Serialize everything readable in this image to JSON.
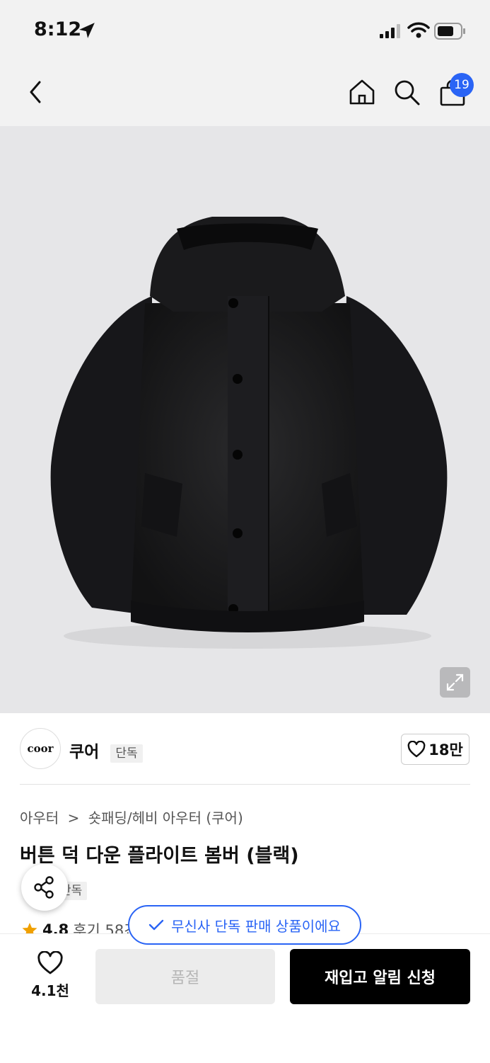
{
  "status_bar": {
    "time": "8:12"
  },
  "nav": {
    "cart_count": "19"
  },
  "brand": {
    "logo_text": "coor",
    "name": "쿠어",
    "tag": "단독",
    "like_count": "18만"
  },
  "breadcrumb": {
    "category": "아우터",
    "separator": ">",
    "subcategory": "숏패딩/헤비 아우터 (쿠어)"
  },
  "product": {
    "title": "버튼 덕 다운 플라이트 봄버 (블랙)",
    "tag": "단독",
    "rating": "4.8",
    "reviews": "후기 58건"
  },
  "toast": {
    "message": "무신사 단독 판매 상품이에요"
  },
  "bottom_bar": {
    "wish_count": "4.1천",
    "soldout_label": "품절",
    "restock_label": "재입고 알림 신청"
  },
  "colors": {
    "accent": "#2a64f5",
    "header_bg": "#f2f2f2",
    "image_bg": "#e6e6e8",
    "primary_button": "#000000"
  }
}
